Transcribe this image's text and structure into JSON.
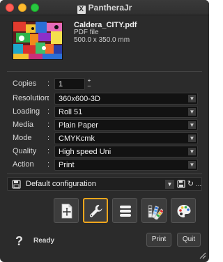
{
  "app": {
    "title": "PantheraJr"
  },
  "file": {
    "name": "Caldera_CITY.pdf",
    "type": "PDF file",
    "size": "500.0 x 350.0 mm"
  },
  "copies": {
    "label": "Copies",
    "value": "1"
  },
  "settings": [
    {
      "label": "Resolution",
      "value": "360x600-3D"
    },
    {
      "label": "Loading",
      "value": "Roll 51"
    },
    {
      "label": "Media",
      "value": "Plain Paper"
    },
    {
      "label": "Mode",
      "value": "CMYKcmk"
    },
    {
      "label": "Quality",
      "value": "High speed Uni"
    },
    {
      "label": "Action",
      "value": "Print"
    }
  ],
  "config": {
    "value": "Default configuration"
  },
  "toolbar": {
    "tools": [
      {
        "icon": "page-layout-icon",
        "active": false
      },
      {
        "icon": "wrench-icon",
        "active": true
      },
      {
        "icon": "stack-icon",
        "active": false
      },
      {
        "icon": "swatches-icon",
        "active": false
      },
      {
        "icon": "palette-icon",
        "active": false
      }
    ]
  },
  "status": {
    "help": "?",
    "text": "Ready",
    "print_label": "Print",
    "quit_label": "Quit"
  },
  "colors": {
    "accent": "#f0a61c",
    "background": "#2b2b2b"
  }
}
